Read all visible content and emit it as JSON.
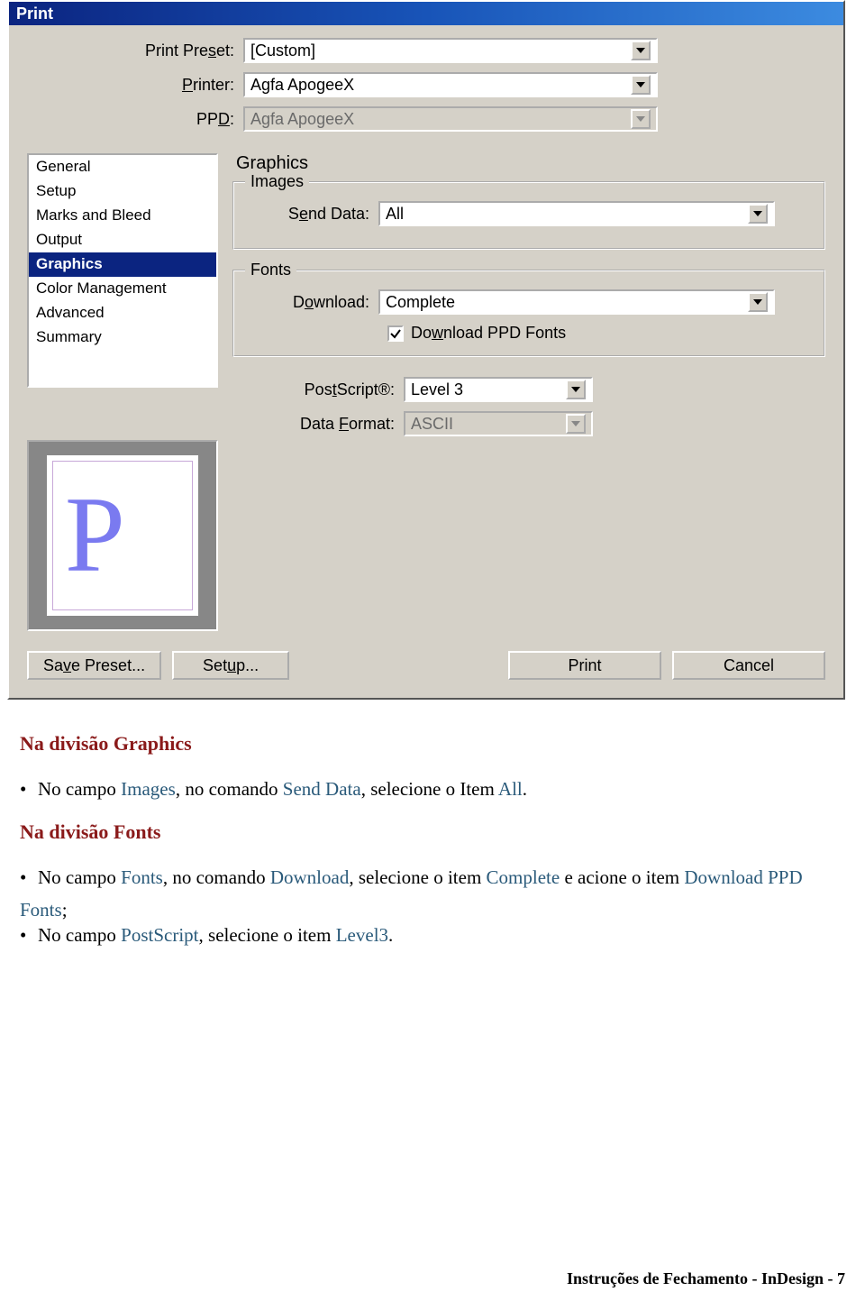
{
  "dialog": {
    "title": "Print",
    "top": {
      "preset_label": "Print Preset:",
      "preset_value": "[Custom]",
      "printer_label": "Printer:",
      "printer_value": "Agfa ApogeeX",
      "ppd_label": "PPD:",
      "ppd_value": "Agfa ApogeeX"
    },
    "panels": [
      "General",
      "Setup",
      "Marks and Bleed",
      "Output",
      "Graphics",
      "Color Management",
      "Advanced",
      "Summary"
    ],
    "selected_panel": "Graphics",
    "graphics": {
      "title": "Graphics",
      "images_legend": "Images",
      "send_data_label": "Send Data:",
      "send_data_value": "All",
      "fonts_legend": "Fonts",
      "download_label": "Download:",
      "download_value": "Complete",
      "ppd_fonts_label": "Download PPD Fonts",
      "ppd_fonts_checked": true,
      "postscript_label": "PostScript®:",
      "postscript_value": "Level 3",
      "dataformat_label": "Data Format:",
      "dataformat_value": "ASCII"
    },
    "buttons": {
      "save_preset": "Save Preset...",
      "setup": "Setup...",
      "print": "Print",
      "cancel": "Cancel"
    },
    "preview_letter": "P"
  },
  "doc": {
    "h1a": "Na divisão Graphics",
    "b1_pre": "No campo ",
    "b1_link1": "Images",
    "b1_mid": ", no comando ",
    "b1_link2": "Send Data",
    "b1_mid2": ", selecione o Item ",
    "b1_link3": "All",
    "b1_end": ".",
    "h1b": "Na divisão Fonts",
    "b2_pre": "No campo ",
    "b2_link1": "Fonts",
    "b2_mid": ", no comando ",
    "b2_link2": "Download",
    "b2_mid2": ", selecione o item ",
    "b2_link3": "Complete",
    "b2_mid3": " e acione o item ",
    "b2_link4": "Download PPD",
    "b3_link1": "Fonts",
    "b3_end": ";",
    "b4_pre": "No campo ",
    "b4_link1": "PostScript",
    "b4_mid": ", selecione o item ",
    "b4_link2": "Level3",
    "b4_end": ".",
    "footer": "Instruções de Fechamento - InDesign - 7"
  }
}
